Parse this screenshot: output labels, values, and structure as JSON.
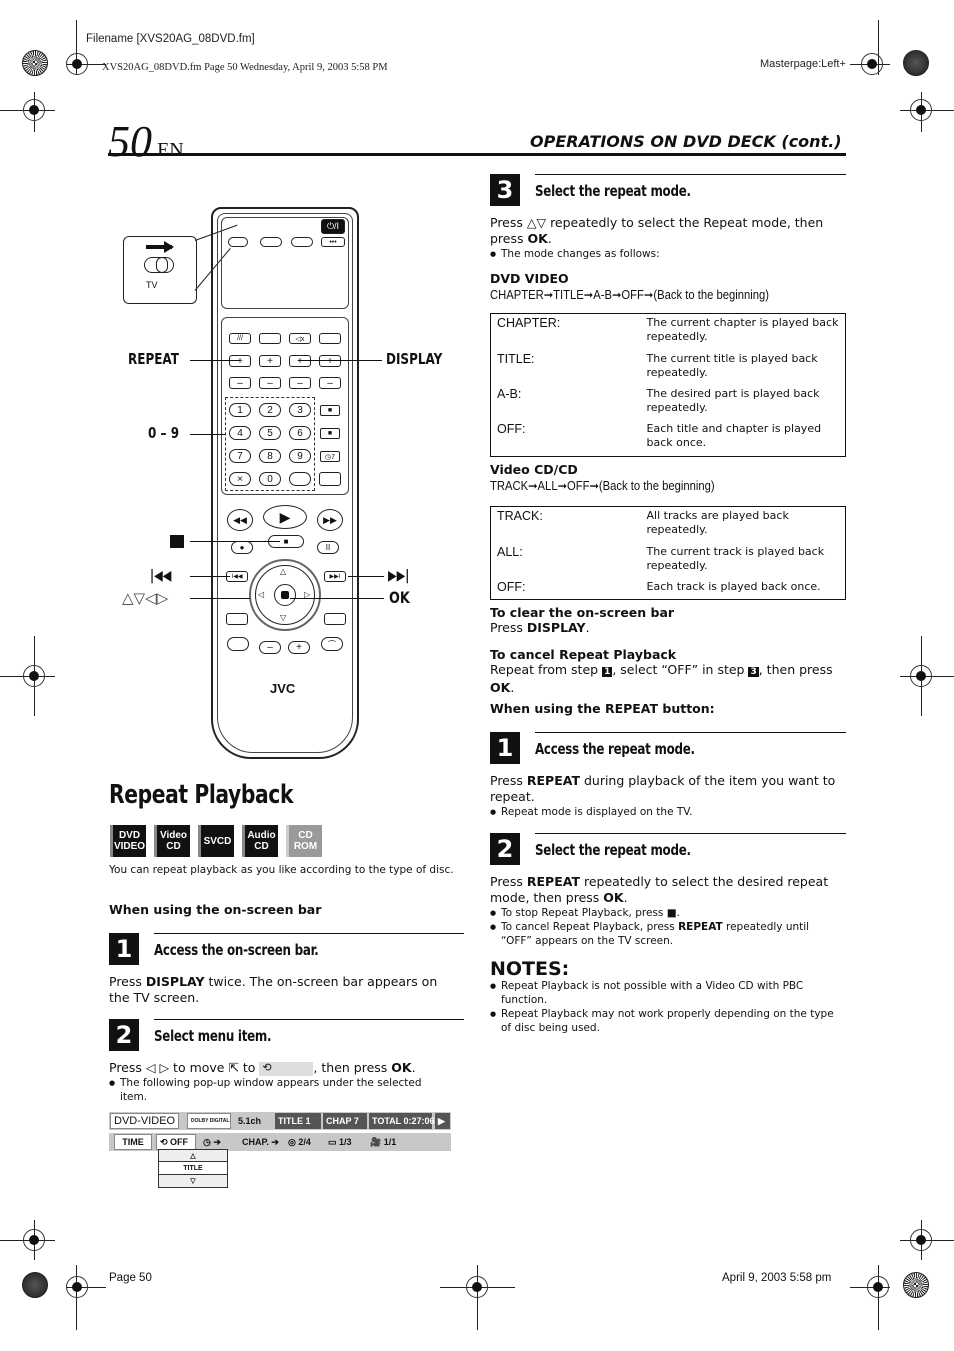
{
  "print_header": {
    "filename": "Filename [XVS20AG_08DVD.fm]",
    "fileinfo": "XVS20AG_08DVD.fm  Page 50  Wednesday, April 9, 2003  5:58 PM",
    "masterpage": "Masterpage:Left+"
  },
  "page_header": {
    "page_number": "50",
    "lang": "EN",
    "section_title": "OPERATIONS ON DVD DECK (cont.)"
  },
  "remote": {
    "brand": "JVC",
    "power_label": "⏻/I",
    "tv_label": "TV",
    "keypad": [
      "1",
      "2",
      "3",
      "4",
      "5",
      "6",
      "7",
      "8",
      "9",
      "×",
      "0"
    ],
    "callouts": {
      "repeat": "REPEAT",
      "display": "DISPLAY",
      "digits": "0 – 9",
      "stop": "■",
      "prev": "|◀◀",
      "next": "▶▶|",
      "arrows": "△▽◁▷",
      "ok": "OK"
    }
  },
  "main": {
    "title": "Repeat Playback",
    "disc_icons": [
      {
        "label": "DVD VIDEO",
        "enabled": true
      },
      {
        "label": "Video CD",
        "enabled": true
      },
      {
        "label": "SVCD",
        "enabled": true
      },
      {
        "label": "Audio CD",
        "enabled": true
      },
      {
        "label": "CD ROM",
        "enabled": false
      }
    ],
    "intro": "You can repeat playback as you like according to the type of disc.",
    "onscreen_heading": "When using the on-screen bar",
    "step1": {
      "num": "1",
      "title": "Access the on-screen bar.",
      "text_pre": "Press ",
      "text_bold": "DISPLAY",
      "text_post": " twice. The on-screen bar appears on the TV screen."
    },
    "step2": {
      "num": "2",
      "title": "Select menu item.",
      "text_pre": "Press ◁ ▷ to move ⇱ to ",
      "text_post": ", then press ",
      "text_bold": "OK",
      "bullet": "The following pop-up window appears under the selected item."
    },
    "osd": {
      "row1": [
        "DVD-VIDEO",
        "DOLBY DIGITAL",
        "5.1ch",
        "TITLE   1",
        "CHAP   7",
        "TOTAL  0:27:06",
        "▶"
      ],
      "row2": [
        "TIME",
        "⟲ OFF",
        "◷ ➔",
        "CHAP. ➔",
        "◎ 2/4",
        "▭ 1/3",
        "🎥 1/1"
      ],
      "popup": [
        "△",
        "TITLE",
        "▽"
      ]
    }
  },
  "right": {
    "step3": {
      "num": "3",
      "title": "Select the repeat mode.",
      "text_pre": "Press △▽ repeatedly to select the Repeat mode, then press ",
      "text_bold": "OK",
      "text_post": ".",
      "bullet": "The mode changes as follows:"
    },
    "dvd_video": {
      "heading": "DVD VIDEO",
      "sequence": "CHAPTER➞TITLE➞A-B➞OFF➞(Back to the beginning)",
      "rows": [
        {
          "mode": "CHAPTER:",
          "desc": "The current chapter is played back repeatedly."
        },
        {
          "mode": "TITLE:",
          "desc": "The current title is played back repeatedly."
        },
        {
          "mode": "A-B:",
          "desc": "The desired part is played back repeatedly."
        },
        {
          "mode": "OFF:",
          "desc": "Each title and chapter is played back once."
        }
      ]
    },
    "video_cd": {
      "heading": "Video CD/CD",
      "sequence": "TRACK➞ALL➞OFF➞(Back to the beginning)",
      "rows": [
        {
          "mode": "TRACK:",
          "desc": "All tracks are played back repeatedly."
        },
        {
          "mode": "ALL:",
          "desc": "The current track is played back repeatedly."
        },
        {
          "mode": "OFF:",
          "desc": "Each track is played back once."
        }
      ]
    },
    "clear_bar": {
      "heading": "To clear the on-screen bar",
      "text_pre": "Press ",
      "text_bold": "DISPLAY",
      "text_post": "."
    },
    "cancel_repeat": {
      "heading": "To cancel Repeat Playback",
      "text_a": "Repeat from step ",
      "step_a": "1",
      "text_b": ", select “OFF” in step ",
      "step_b": "3",
      "text_c": ", then press ",
      "text_bold": "OK",
      "text_d": "."
    },
    "repeat_button_heading": "When using the REPEAT button:",
    "rstep1": {
      "num": "1",
      "title": "Access the repeat mode.",
      "text_pre": "Press ",
      "text_bold": "REPEAT",
      "text_post": " during playback of the item you want to repeat.",
      "bullet": "Repeat mode is displayed on the TV."
    },
    "rstep2": {
      "num": "2",
      "title": "Select the repeat mode.",
      "text_pre": "Press ",
      "text_bold": "REPEAT",
      "text_mid": " repeatedly to select the desired repeat mode, then press ",
      "text_bold2": "OK",
      "text_post": ".",
      "bullet1": "To stop Repeat Playback, press ■.",
      "bullet2_pre": "To cancel Repeat Playback, press ",
      "bullet2_bold": "REPEAT",
      "bullet2_post": " repeatedly until “OFF” appears on the TV screen."
    },
    "notes": {
      "heading": "NOTES:",
      "items": [
        "Repeat Playback is not possible with a Video CD with PBC function.",
        "Repeat Playback may not work properly depending on the type of disc being used."
      ]
    }
  },
  "footer": {
    "page": "Page 50",
    "datetime": "April 9, 2003 5:58 pm"
  }
}
